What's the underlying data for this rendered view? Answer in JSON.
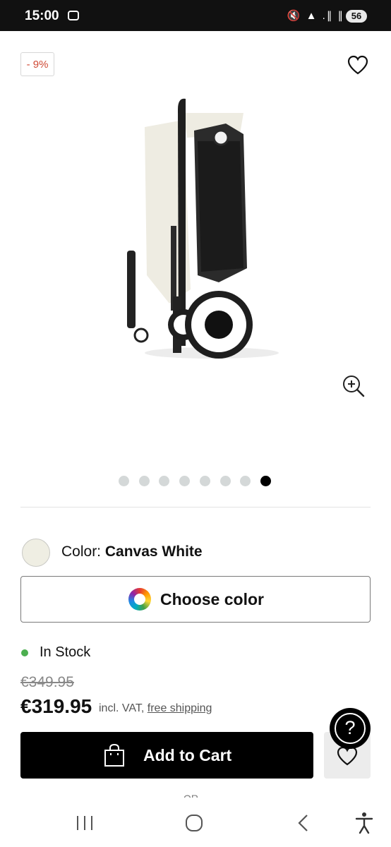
{
  "status_bar": {
    "time": "15:00",
    "icons": "🔇 ▲ .∥ ∥",
    "battery": "56"
  },
  "product": {
    "discount_badge": "- 9%",
    "gallery": {
      "image_count": 8,
      "active_index": 7
    },
    "color": {
      "label": "Color:",
      "value": "Canvas White",
      "swatch_color": "#efeee3"
    },
    "choose_color_label": "Choose color",
    "stock": {
      "text": "In Stock",
      "color": "#4caf50"
    },
    "old_price": "€349.95",
    "price": "€319.95",
    "price_note": "incl. VAT,",
    "shipping_link": "free shipping",
    "add_to_cart_label": "Add to Cart",
    "or_text": "OR"
  },
  "help_label": "?",
  "colors": {
    "accent": "#000000",
    "discount": "#d04a35",
    "status_bar": "#111111"
  }
}
